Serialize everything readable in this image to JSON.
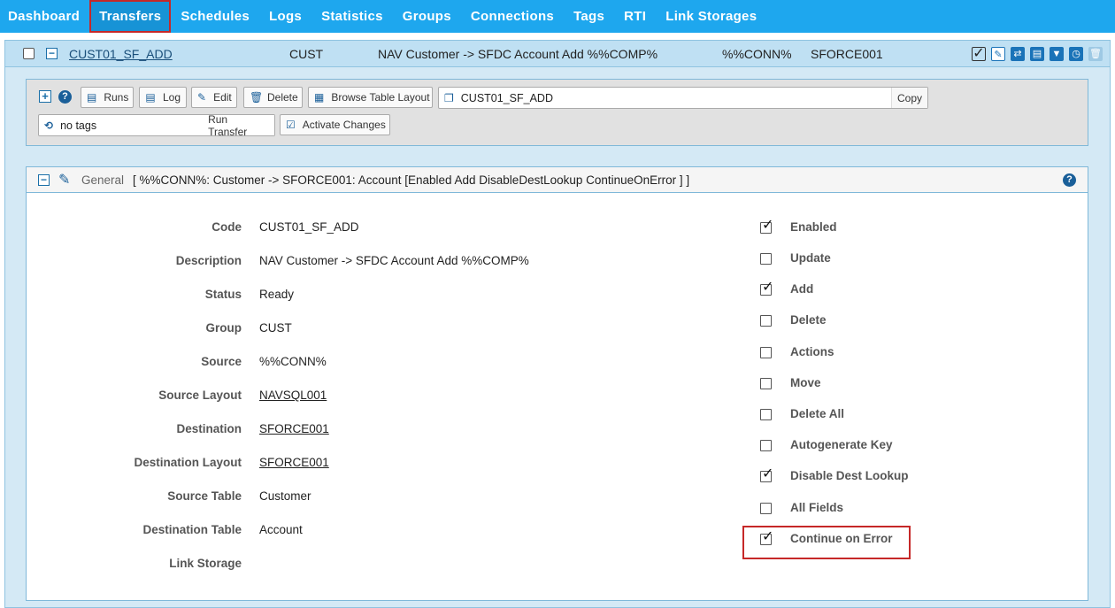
{
  "nav": {
    "items": [
      "Dashboard",
      "Transfers",
      "Schedules",
      "Logs",
      "Statistics",
      "Groups",
      "Connections",
      "Tags",
      "RTI",
      "Link Storages"
    ],
    "active": "Transfers"
  },
  "transfer": {
    "code_link": "CUST01_SF_ADD",
    "group": "CUST",
    "description": "NAV Customer -> SFDC Account Add %%COMP%",
    "source": "%%CONN%",
    "destination": "SFORCE001",
    "header_icons": [
      "checkbox-icon",
      "edit-note-icon",
      "refresh-icon",
      "layout-icon",
      "filter-icon",
      "clock-icon",
      "trash-icon"
    ]
  },
  "toolbar": {
    "runs": "Runs",
    "log": "Log",
    "edit": "Edit",
    "delete": "Delete",
    "browse": "Browse Table Layout",
    "copy_field_value": "CUST01_SF_ADD",
    "copy": "Copy",
    "tags_value": "no tags",
    "run_transfer": "Run Transfer",
    "activate": "Activate Changes"
  },
  "general": {
    "title": "General",
    "summary": "[ %%CONN%: Customer -> SFORCE001: Account [Enabled Add DisableDestLookup ContinueOnError ] ]",
    "fields": [
      {
        "label": "Code",
        "value": "CUST01_SF_ADD",
        "link": false
      },
      {
        "label": "Description",
        "value": "NAV Customer -> SFDC Account Add %%COMP%",
        "link": false
      },
      {
        "label": "Status",
        "value": "Ready",
        "link": false
      },
      {
        "label": "Group",
        "value": "CUST",
        "link": false
      },
      {
        "label": "Source",
        "value": "%%CONN%",
        "link": false
      },
      {
        "label": "Source Layout",
        "value": "NAVSQL001",
        "link": true
      },
      {
        "label": "Destination",
        "value": "SFORCE001",
        "link": true
      },
      {
        "label": "Destination Layout",
        "value": "SFORCE001",
        "link": true
      },
      {
        "label": "Source Table",
        "value": "Customer",
        "link": false
      },
      {
        "label": "Destination Table",
        "value": "Account",
        "link": false
      },
      {
        "label": "Link Storage",
        "value": "",
        "link": false
      }
    ],
    "options": [
      {
        "label": "Enabled",
        "checked": true
      },
      {
        "label": "Update",
        "checked": false
      },
      {
        "label": "Add",
        "checked": true
      },
      {
        "label": "Delete",
        "checked": false
      },
      {
        "label": "Actions",
        "checked": false
      },
      {
        "label": "Move",
        "checked": false
      },
      {
        "label": "Delete All",
        "checked": false
      },
      {
        "label": "Autogenerate Key",
        "checked": false
      },
      {
        "label": "Disable Dest Lookup",
        "checked": true
      },
      {
        "label": "All Fields",
        "checked": false
      },
      {
        "label": "Continue on Error",
        "checked": true
      }
    ]
  }
}
